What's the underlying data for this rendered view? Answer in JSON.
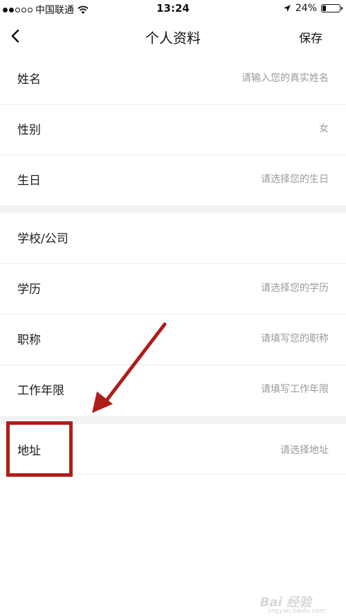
{
  "status_bar": {
    "carrier": "中国联通",
    "time": "13:24",
    "battery": "24%",
    "battery_level": 0.24
  },
  "nav": {
    "title": "个人资料",
    "save_label": "保存"
  },
  "group1": [
    {
      "label": "姓名",
      "value": "请输入您的真实姓名"
    },
    {
      "label": "性别",
      "value": "女"
    },
    {
      "label": "生日",
      "value": "请选择您的生日"
    }
  ],
  "group2": [
    {
      "label": "学校/公司",
      "value": ""
    },
    {
      "label": "学历",
      "value": "请选择您的学历"
    },
    {
      "label": "职称",
      "value": "请填写您的职称"
    },
    {
      "label": "工作年限",
      "value": "请填写工作年限"
    }
  ],
  "group3": [
    {
      "label": "地址",
      "value": "请选择地址"
    }
  ],
  "watermark": {
    "text": "Bai 经验",
    "sub": "jingyan.baidu.com"
  },
  "colors": {
    "annotation": "#b01c17",
    "placeholder": "#9a9a9a",
    "separator": "#f2f2f2"
  }
}
